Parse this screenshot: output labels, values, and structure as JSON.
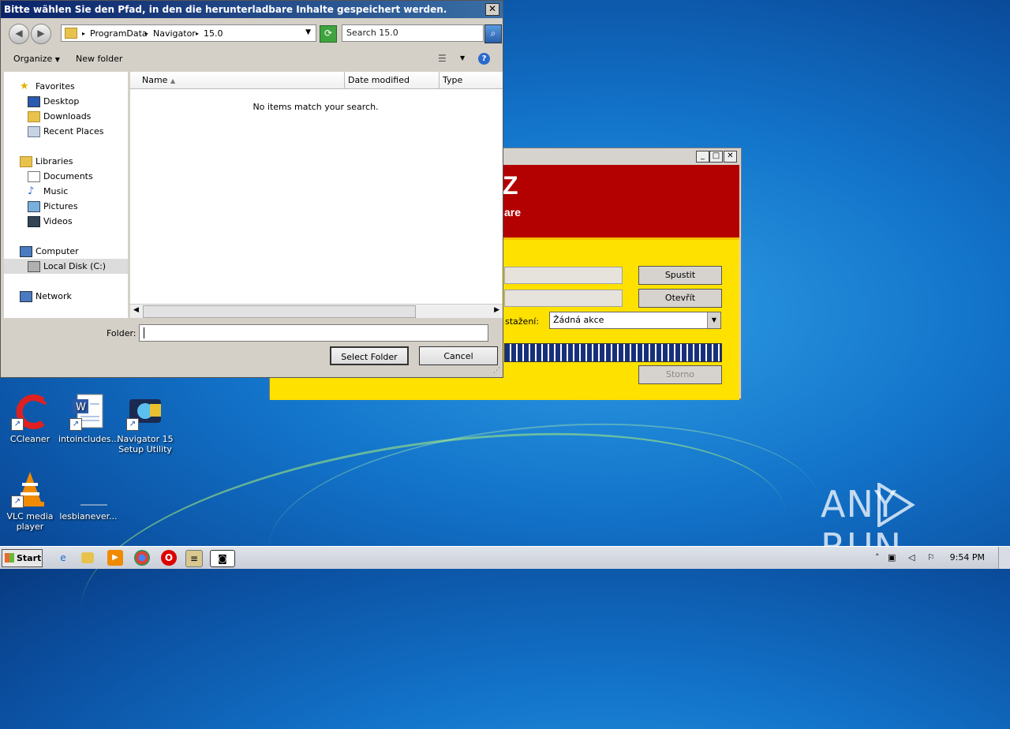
{
  "dialog": {
    "title": "Bitte wählen Sie den Pfad, in den die herunterladbare Inhalte gespeichert werden.",
    "close_glyph": "✕",
    "breadcrumb": [
      "ProgramData",
      "Navigator",
      "15.0"
    ],
    "search_placeholder": "Search 15.0",
    "toolbar": {
      "organize": "Organize",
      "new_folder": "New folder"
    },
    "nav": {
      "favorites": "Favorites",
      "desktop": "Desktop",
      "downloads": "Downloads",
      "recent": "Recent Places",
      "libraries": "Libraries",
      "documents": "Documents",
      "music": "Music",
      "pictures": "Pictures",
      "videos": "Videos",
      "computer": "Computer",
      "local_disk": "Local Disk (C:)",
      "network": "Network"
    },
    "columns": {
      "name": "Name",
      "date": "Date modified",
      "type": "Type"
    },
    "empty_message": "No items match your search.",
    "folder_label": "Folder:",
    "folder_value": "",
    "select_button": "Select Folder",
    "cancel_button": "Cancel"
  },
  "background_app": {
    "header_big": "Z",
    "header_small": "are",
    "run_button": "Spustit",
    "open_button": "Otevřít",
    "after_download_label": "stažení:",
    "after_download_value": "Žádná akce",
    "cancel_button": "Storno",
    "colors": {
      "header": "#b30000",
      "body": "#ffe100",
      "progress": "#17307a"
    }
  },
  "desktop_icons": [
    {
      "label": "CCleaner",
      "icon": "ccleaner-icon"
    },
    {
      "label": "intoincludes...",
      "icon": "word-document-icon"
    },
    {
      "label": "Navigator 15 Setup Utility",
      "icon": "navigator-setup-icon"
    },
    {
      "label": "VLC media player",
      "icon": "vlc-icon"
    },
    {
      "label": "lesbianever...",
      "icon": "blank-file-icon"
    }
  ],
  "taskbar": {
    "start_label": "Start",
    "clock": "9:54 PM"
  },
  "watermark": {
    "left": "ANY",
    "right": "RUN"
  }
}
